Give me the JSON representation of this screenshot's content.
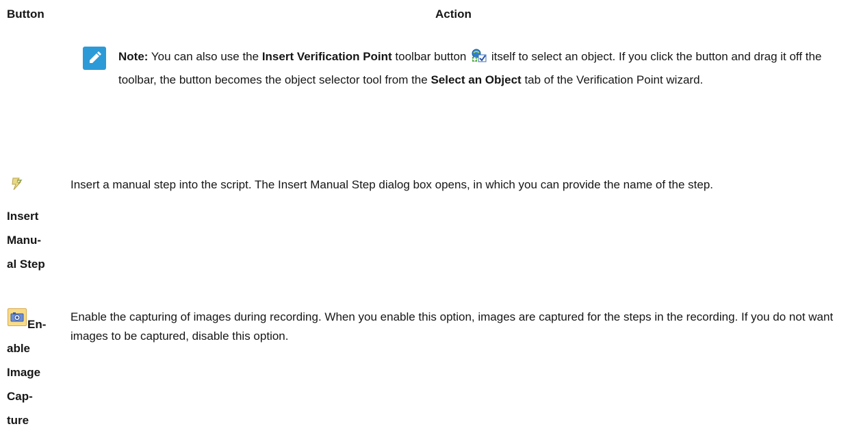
{
  "header": {
    "button_col": "Button",
    "action_col": "Action"
  },
  "note": {
    "icon": "pencil-note-icon",
    "label": "Note:",
    "text_1": " You can also use the ",
    "bold_1": "Insert Verification Point",
    "text_2": " toolbar button ",
    "toolbar_icon": "verification-point-icon",
    "text_3": " itself to select an object. If you click the button and drag it off the toolbar, the button becomes the object selector tool from the ",
    "bold_2": "Select an Object",
    "text_4": " tab of the Verification Point wizard."
  },
  "rows": [
    {
      "icon": "manual-step-icon",
      "label_lines": [
        "Insert",
        "Manu-",
        "al Step"
      ],
      "description": "Insert a manual step into the script. The Insert Manual Step dialog box opens, in which you can provide the name of the step."
    },
    {
      "icon": "image-capture-icon",
      "label_lines": [
        "En-",
        "able",
        "Image",
        "Cap-",
        "ture"
      ],
      "description": "Enable the capturing of images during recording. When you enable this option, images are captured for the steps in the recording. If you do not want images to be captured, disable this option."
    }
  ],
  "colors": {
    "note_icon_bg": "#2c9ad7",
    "text": "#161616"
  }
}
